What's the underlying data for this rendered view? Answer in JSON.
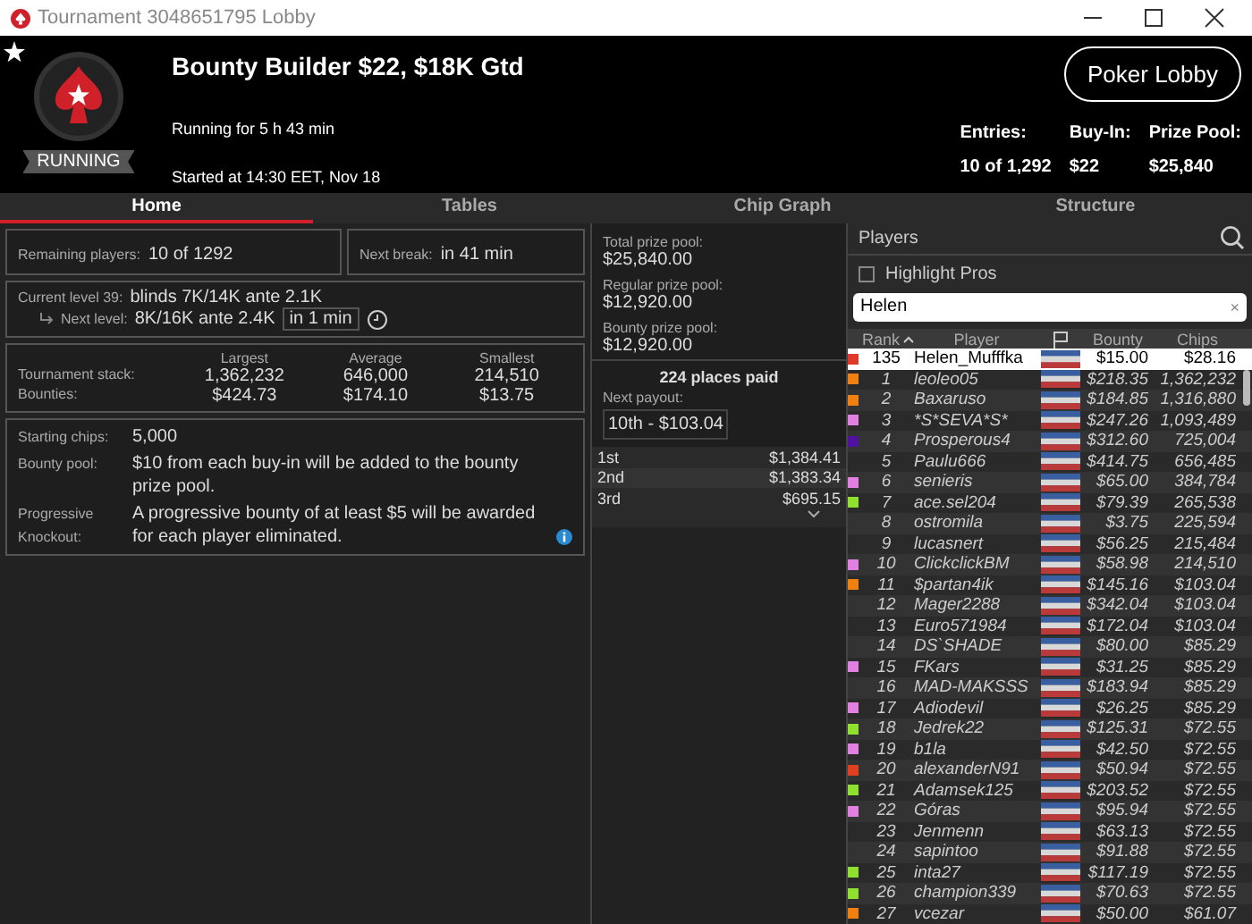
{
  "window": {
    "title": "Tournament 3048651795 Lobby"
  },
  "header": {
    "status": "RUNNING",
    "title": "Bounty Builder $22, $18K Gtd",
    "running": "Running for 5 h 43 min",
    "started": "Started at 14:30 EET, Nov 18",
    "lobby_button": "Poker Lobby",
    "stats": [
      {
        "label": "Entries:",
        "value": "10 of 1,292"
      },
      {
        "label": "Buy-In:",
        "value": "$22"
      },
      {
        "label": "Prize Pool:",
        "value": "$25,840"
      }
    ]
  },
  "tabs": [
    {
      "label": "Home",
      "selected": true
    },
    {
      "label": "Tables",
      "selected": false
    },
    {
      "label": "Chip Graph",
      "selected": false
    },
    {
      "label": "Structure",
      "selected": false
    }
  ],
  "summary": {
    "remaining": {
      "label": "Remaining players:",
      "value": "10 of 1292"
    },
    "next_break": {
      "label": "Next break:",
      "value": "in 41 min"
    },
    "current_level": {
      "label": "Current level 39:",
      "value": "blinds 7K/14K ante 2.1K"
    },
    "next_level": {
      "label": "Next level:",
      "value": "8K/16K ante 2.4K",
      "timer": "in 1 min"
    },
    "stacks": {
      "columns": [
        "Largest",
        "Average",
        "Smallest"
      ],
      "rows": [
        {
          "label": "Tournament stack:",
          "values": [
            "1,362,232",
            "646,000",
            "214,510"
          ]
        },
        {
          "label": "Bounties:",
          "values": [
            "$424.73",
            "$174.10",
            "$13.75"
          ]
        }
      ]
    },
    "info": [
      {
        "label": "Starting chips:",
        "value": "5,000"
      },
      {
        "label": "Bounty pool:",
        "value": "$10 from each buy-in will be added to the bounty prize pool."
      },
      {
        "label": "Progressive Knockout:",
        "value": "A progressive bounty of at least $5 will be awarded for each player eliminated."
      }
    ]
  },
  "prizes": {
    "pools": [
      {
        "label": "Total prize pool:",
        "value": "$25,840.00"
      },
      {
        "label": "Regular prize pool:",
        "value": "$12,920.00"
      },
      {
        "label": "Bounty prize pool:",
        "value": "$12,920.00"
      }
    ],
    "places_paid": "224 places paid",
    "next_payout": {
      "label": "Next payout:",
      "value": "10th - $103.04"
    },
    "payouts": [
      {
        "place": "1st",
        "amount": "$1,384.41"
      },
      {
        "place": "2nd",
        "amount": "$1,383.34"
      },
      {
        "place": "3rd",
        "amount": "$695.15"
      }
    ]
  },
  "players": {
    "title": "Players",
    "highlight_pros": {
      "label": "Highlight Pros",
      "checked": false
    },
    "search": {
      "value": "Helen",
      "clear": "×"
    },
    "columns": [
      "Rank",
      "Player",
      "Bounty",
      "Chips"
    ],
    "rows": [
      {
        "rank": "135",
        "name": "Helen_Mufffka",
        "bounty": "$15.00",
        "chips": "$28.16",
        "color": "#e0392b",
        "selected": true
      },
      {
        "rank": "1",
        "name": "leoleo05",
        "bounty": "$218.35",
        "chips": "1,362,232",
        "color": "#f08010",
        "selected": false
      },
      {
        "rank": "2",
        "name": "Baxaruso",
        "bounty": "$184.85",
        "chips": "1,316,880",
        "color": "#f08010",
        "selected": false
      },
      {
        "rank": "3",
        "name": "*S*SEVA*S*",
        "bounty": "$247.26",
        "chips": "1,093,489",
        "color": "#e080e0",
        "selected": false
      },
      {
        "rank": "4",
        "name": "Prosperous4",
        "bounty": "$312.60",
        "chips": "725,004",
        "color": "#5010a0",
        "selected": false
      },
      {
        "rank": "5",
        "name": "Paulu666",
        "bounty": "$414.75",
        "chips": "656,485",
        "selected": false
      },
      {
        "rank": "6",
        "name": "senieris",
        "bounty": "$65.00",
        "chips": "384,784",
        "color": "#e080e0",
        "selected": false
      },
      {
        "rank": "7",
        "name": "ace.sel204",
        "bounty": "$79.39",
        "chips": "265,538",
        "color": "#90e030",
        "selected": false
      },
      {
        "rank": "8",
        "name": "ostromila",
        "bounty": "$3.75",
        "chips": "225,594",
        "selected": false
      },
      {
        "rank": "9",
        "name": "lucasnert",
        "bounty": "$56.25",
        "chips": "215,484",
        "selected": false
      },
      {
        "rank": "10",
        "name": "ClickclickBM",
        "bounty": "$58.98",
        "chips": "214,510",
        "color": "#e080e0",
        "selected": false
      },
      {
        "rank": "11",
        "name": "$partan4ik",
        "bounty": "$145.16",
        "chips": "$103.04",
        "color": "#f08010",
        "selected": false
      },
      {
        "rank": "12",
        "name": "Mager2288",
        "bounty": "$342.04",
        "chips": "$103.04",
        "selected": false
      },
      {
        "rank": "13",
        "name": "Euro571984",
        "bounty": "$172.04",
        "chips": "$103.04",
        "selected": false
      },
      {
        "rank": "14",
        "name": "DS`SHADE",
        "bounty": "$80.00",
        "chips": "$85.29",
        "selected": false
      },
      {
        "rank": "15",
        "name": "FKars",
        "bounty": "$31.25",
        "chips": "$85.29",
        "color": "#e080e0",
        "selected": false
      },
      {
        "rank": "16",
        "name": "MAD-MAKSSS",
        "bounty": "$183.94",
        "chips": "$85.29",
        "selected": false
      },
      {
        "rank": "17",
        "name": "Adiodevil",
        "bounty": "$26.25",
        "chips": "$85.29",
        "color": "#e080e0",
        "selected": false
      },
      {
        "rank": "18",
        "name": "Jedrek22",
        "bounty": "$125.31",
        "chips": "$72.55",
        "color": "#90e030",
        "selected": false
      },
      {
        "rank": "19",
        "name": "b1la",
        "bounty": "$42.50",
        "chips": "$72.55",
        "color": "#e080e0",
        "selected": false
      },
      {
        "rank": "20",
        "name": "alexanderN91",
        "bounty": "$50.94",
        "chips": "$72.55",
        "color": "#e04020",
        "selected": false
      },
      {
        "rank": "21",
        "name": "Adamsek125",
        "bounty": "$203.52",
        "chips": "$72.55",
        "color": "#90e030",
        "selected": false
      },
      {
        "rank": "22",
        "name": "Góras",
        "bounty": "$95.94",
        "chips": "$72.55",
        "color": "#e080e0",
        "selected": false
      },
      {
        "rank": "23",
        "name": "Jenmenn",
        "bounty": "$63.13",
        "chips": "$72.55",
        "selected": false
      },
      {
        "rank": "24",
        "name": "sapintoo",
        "bounty": "$91.88",
        "chips": "$72.55",
        "selected": false
      },
      {
        "rank": "25",
        "name": "inta27",
        "bounty": "$117.19",
        "chips": "$72.55",
        "color": "#90e030",
        "selected": false
      },
      {
        "rank": "26",
        "name": "champion339",
        "bounty": "$70.63",
        "chips": "$72.55",
        "color": "#90e030",
        "selected": false
      },
      {
        "rank": "27",
        "name": "vcezar",
        "bounty": "$50.00",
        "chips": "$61.07",
        "color": "#f08010",
        "selected": false
      }
    ]
  }
}
